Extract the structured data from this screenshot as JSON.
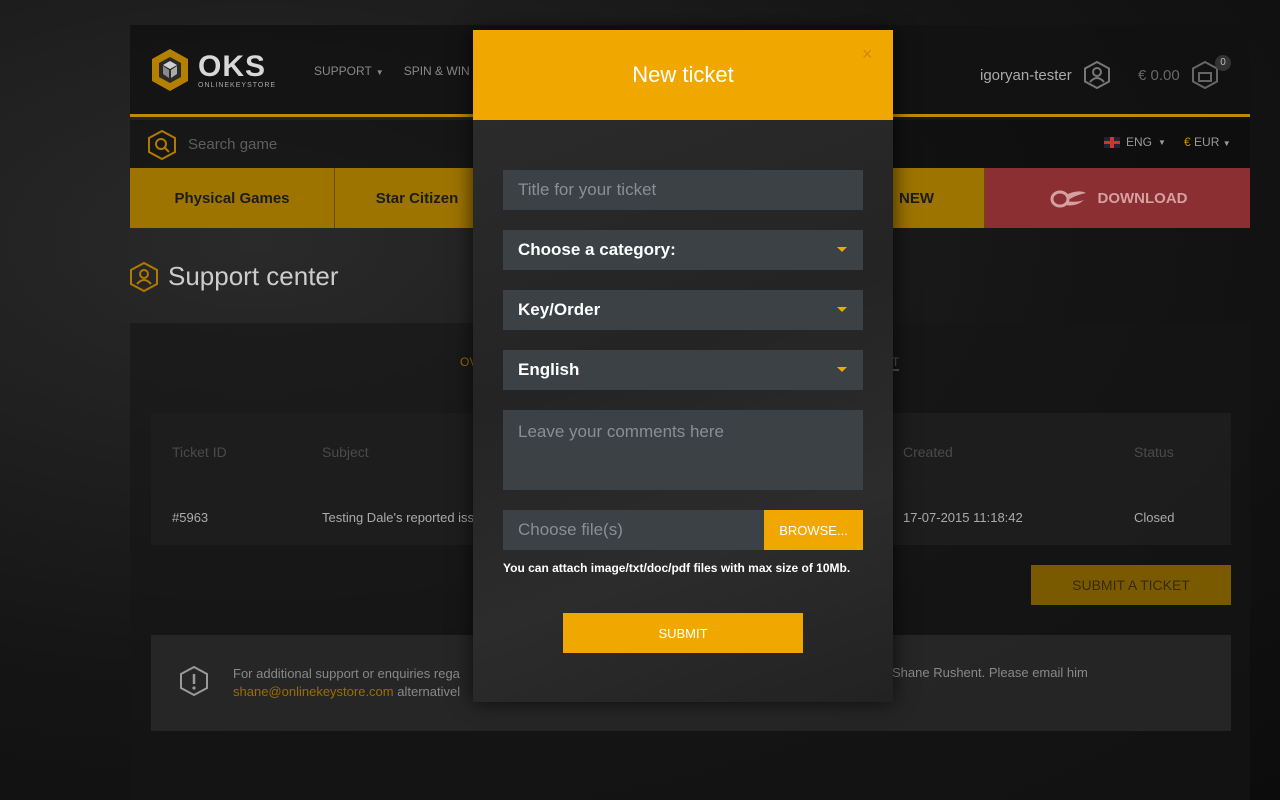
{
  "header": {
    "logo_text": "OKS",
    "logo_sub": "ONLINEKEYSTORE",
    "nav": [
      {
        "label": "SUPPORT"
      },
      {
        "label": "SPIN & WIN"
      }
    ],
    "username": "igoryan-tester",
    "cart_total": "€ 0.00",
    "cart_count": "0"
  },
  "search": {
    "placeholder": "Search game",
    "language": "ENG",
    "currency_symbol": "€",
    "currency": "EUR"
  },
  "categories": [
    {
      "label": "Physical Games"
    },
    {
      "label": "Star Citizen"
    },
    {
      "label": "NEW"
    },
    {
      "label": "DOWNLOAD"
    }
  ],
  "support": {
    "title": "Support center",
    "tab_left": "OV",
    "tab_right": "T",
    "table": {
      "headers": [
        "Ticket ID",
        "Subject",
        "Created",
        "Status"
      ],
      "rows": [
        {
          "id": "#5963",
          "subject": "Testing Dale's reported iss",
          "created": "17-07-2015 11:18:42",
          "status": "Closed"
        }
      ]
    },
    "submit_ticket_label": "SUBMIT A TICKET",
    "info_left_line1": "For additional support or enquiries rega",
    "info_email": "shane@onlinekeystore.com",
    "info_left_line2_rest": " alternativel",
    "info_right": "Shane Rushent. Please email him"
  },
  "modal": {
    "title": "New ticket",
    "close": "×",
    "title_placeholder": "Title for your ticket",
    "category": "Choose a category:",
    "subcategory": "Key/Order",
    "language": "English",
    "comments_placeholder": "Leave your comments here",
    "file_placeholder": "Choose file(s)",
    "browse_label": "BROWSE...",
    "file_hint": "You can attach image/txt/doc/pdf files with max size of 10Mb.",
    "submit_label": "SUBMIT"
  },
  "colors": {
    "accent": "#f0a800",
    "download": "#8b2f32"
  }
}
